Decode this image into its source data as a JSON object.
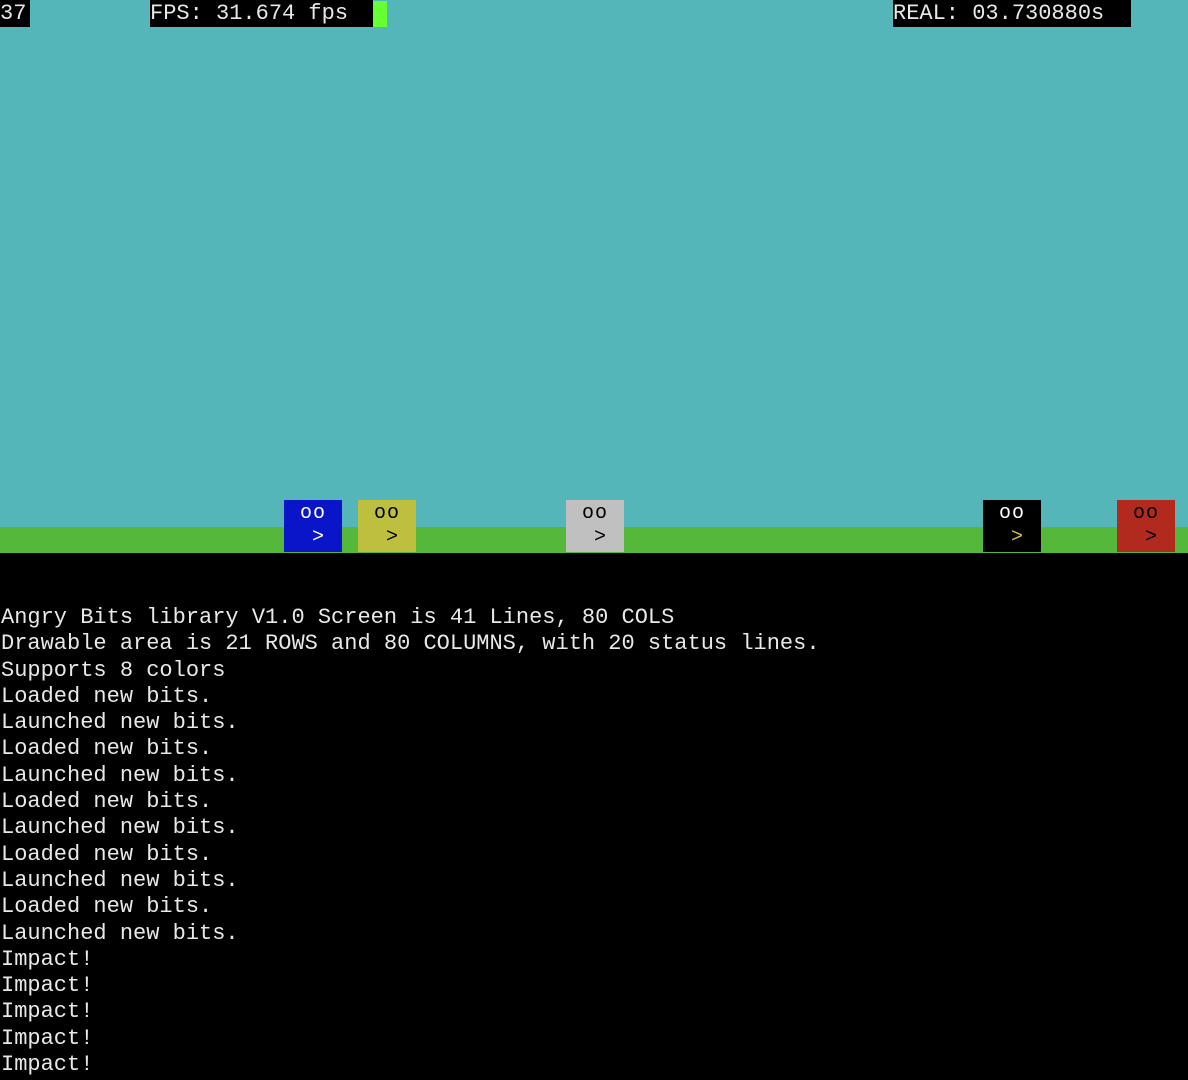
{
  "hud": {
    "frame_counter": "37",
    "fps_text": "FPS: 31.674 fps",
    "real_text": "REAL: 03.730880s"
  },
  "colors": {
    "sky": "#55b6b9",
    "ground": "#55b83a",
    "cursor": "#66ff33",
    "background": "#000000",
    "text": "#e8e8e8"
  },
  "bits": [
    {
      "eyes": "oo",
      "mouth": ">",
      "color": "blue",
      "bg": "#0a14c8",
      "fg": "#ffffff"
    },
    {
      "eyes": "oo",
      "mouth": ">",
      "color": "yellow",
      "bg": "#bfbf3f",
      "fg": "#000000"
    },
    {
      "eyes": "oo",
      "mouth": ">",
      "color": "white",
      "bg": "#c0c0c0",
      "fg": "#000000"
    },
    {
      "eyes": "oo",
      "mouth": ">",
      "color": "black",
      "bg": "#000000",
      "fg": "#ffffff",
      "mouth_fg": "#d7c23a"
    },
    {
      "eyes": "oo",
      "mouth": ">",
      "color": "red",
      "bg": "#b22a1e",
      "fg": "#000000"
    }
  ],
  "log": [
    "Angry Bits library V1.0 Screen is 41 Lines, 80 COLS",
    "Drawable area is 21 ROWS and 80 COLUMNS, with 20 status lines.",
    "Supports 8 colors",
    "Loaded new bits.",
    "Launched new bits.",
    "Loaded new bits.",
    "Launched new bits.",
    "Loaded new bits.",
    "Launched new bits.",
    "Loaded new bits.",
    "Launched new bits.",
    "Loaded new bits.",
    "Launched new bits.",
    "Impact!",
    "Impact!",
    "Impact!",
    "Impact!",
    "Impact!"
  ]
}
